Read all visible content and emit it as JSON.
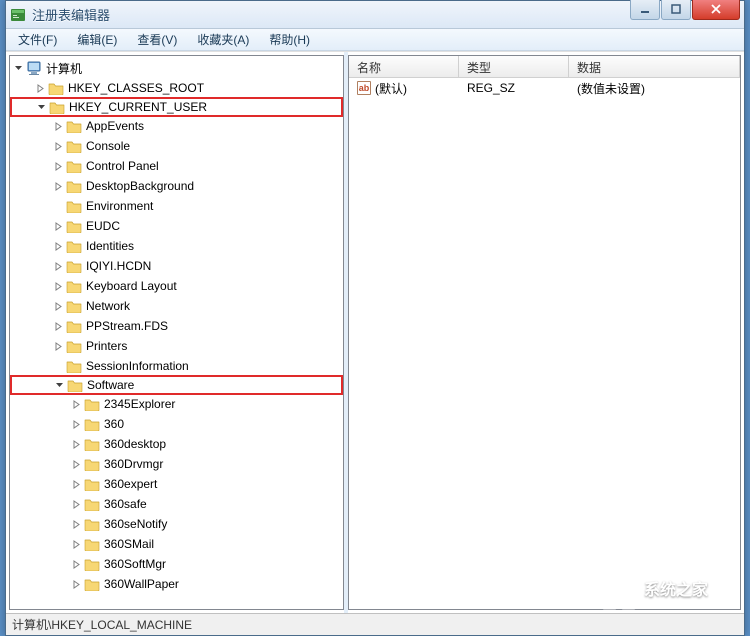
{
  "window": {
    "title": "注册表编辑器"
  },
  "menu": {
    "file": "文件(F)",
    "edit": "编辑(E)",
    "view": "查看(V)",
    "favorites": "收藏夹(A)",
    "help": "帮助(H)"
  },
  "tree": {
    "root": "计算机",
    "nodes": [
      {
        "label": "HKEY_CLASSES_ROOT",
        "collapsed": true,
        "depth": 1
      },
      {
        "label": "HKEY_CURRENT_USER",
        "expanded": true,
        "highlight": true,
        "depth": 1
      },
      {
        "label": "AppEvents",
        "collapsed": true,
        "depth": 2
      },
      {
        "label": "Console",
        "collapsed": true,
        "depth": 2
      },
      {
        "label": "Control Panel",
        "collapsed": true,
        "depth": 2
      },
      {
        "label": "DesktopBackground",
        "collapsed": true,
        "depth": 2
      },
      {
        "label": "Environment",
        "leaf": true,
        "depth": 2
      },
      {
        "label": "EUDC",
        "collapsed": true,
        "depth": 2
      },
      {
        "label": "Identities",
        "collapsed": true,
        "depth": 2
      },
      {
        "label": "IQIYI.HCDN",
        "collapsed": true,
        "depth": 2
      },
      {
        "label": "Keyboard Layout",
        "collapsed": true,
        "depth": 2
      },
      {
        "label": "Network",
        "collapsed": true,
        "depth": 2
      },
      {
        "label": "PPStream.FDS",
        "collapsed": true,
        "depth": 2
      },
      {
        "label": "Printers",
        "collapsed": true,
        "depth": 2
      },
      {
        "label": "SessionInformation",
        "leaf": true,
        "depth": 2
      },
      {
        "label": "Software",
        "expanded": true,
        "highlight": true,
        "depth": 2
      },
      {
        "label": "2345Explorer",
        "collapsed": true,
        "depth": 3
      },
      {
        "label": "360",
        "collapsed": true,
        "depth": 3
      },
      {
        "label": "360desktop",
        "collapsed": true,
        "depth": 3
      },
      {
        "label": "360Drvmgr",
        "collapsed": true,
        "depth": 3
      },
      {
        "label": "360expert",
        "collapsed": true,
        "depth": 3
      },
      {
        "label": "360safe",
        "collapsed": true,
        "depth": 3
      },
      {
        "label": "360seNotify",
        "collapsed": true,
        "depth": 3
      },
      {
        "label": "360SMail",
        "collapsed": true,
        "depth": 3
      },
      {
        "label": "360SoftMgr",
        "collapsed": true,
        "depth": 3
      },
      {
        "label": "360WallPaper",
        "collapsed": true,
        "depth": 3
      }
    ]
  },
  "list": {
    "cols": {
      "name": "名称",
      "type": "类型",
      "data": "数据"
    },
    "rows": [
      {
        "name": "(默认)",
        "type": "REG_SZ",
        "data": "(数值未设置)"
      }
    ]
  },
  "status": {
    "path": "计算机\\HKEY_LOCAL_MACHINE"
  },
  "icons": {
    "ab": "ab"
  },
  "watermark": {
    "cn": "系统之家",
    "en": "XITONGZHIJIA.NET"
  }
}
